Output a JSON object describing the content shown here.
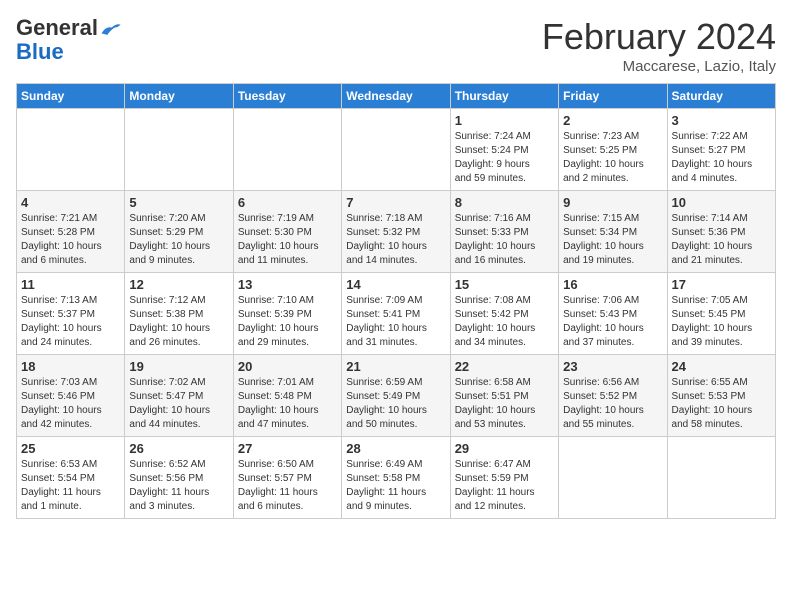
{
  "header": {
    "logo_general": "General",
    "logo_blue": "Blue",
    "month_year": "February 2024",
    "location": "Maccarese, Lazio, Italy"
  },
  "weekdays": [
    "Sunday",
    "Monday",
    "Tuesday",
    "Wednesday",
    "Thursday",
    "Friday",
    "Saturday"
  ],
  "weeks": [
    [
      {
        "day": "",
        "info": ""
      },
      {
        "day": "",
        "info": ""
      },
      {
        "day": "",
        "info": ""
      },
      {
        "day": "",
        "info": ""
      },
      {
        "day": "1",
        "info": "Sunrise: 7:24 AM\nSunset: 5:24 PM\nDaylight: 9 hours\nand 59 minutes."
      },
      {
        "day": "2",
        "info": "Sunrise: 7:23 AM\nSunset: 5:25 PM\nDaylight: 10 hours\nand 2 minutes."
      },
      {
        "day": "3",
        "info": "Sunrise: 7:22 AM\nSunset: 5:27 PM\nDaylight: 10 hours\nand 4 minutes."
      }
    ],
    [
      {
        "day": "4",
        "info": "Sunrise: 7:21 AM\nSunset: 5:28 PM\nDaylight: 10 hours\nand 6 minutes."
      },
      {
        "day": "5",
        "info": "Sunrise: 7:20 AM\nSunset: 5:29 PM\nDaylight: 10 hours\nand 9 minutes."
      },
      {
        "day": "6",
        "info": "Sunrise: 7:19 AM\nSunset: 5:30 PM\nDaylight: 10 hours\nand 11 minutes."
      },
      {
        "day": "7",
        "info": "Sunrise: 7:18 AM\nSunset: 5:32 PM\nDaylight: 10 hours\nand 14 minutes."
      },
      {
        "day": "8",
        "info": "Sunrise: 7:16 AM\nSunset: 5:33 PM\nDaylight: 10 hours\nand 16 minutes."
      },
      {
        "day": "9",
        "info": "Sunrise: 7:15 AM\nSunset: 5:34 PM\nDaylight: 10 hours\nand 19 minutes."
      },
      {
        "day": "10",
        "info": "Sunrise: 7:14 AM\nSunset: 5:36 PM\nDaylight: 10 hours\nand 21 minutes."
      }
    ],
    [
      {
        "day": "11",
        "info": "Sunrise: 7:13 AM\nSunset: 5:37 PM\nDaylight: 10 hours\nand 24 minutes."
      },
      {
        "day": "12",
        "info": "Sunrise: 7:12 AM\nSunset: 5:38 PM\nDaylight: 10 hours\nand 26 minutes."
      },
      {
        "day": "13",
        "info": "Sunrise: 7:10 AM\nSunset: 5:39 PM\nDaylight: 10 hours\nand 29 minutes."
      },
      {
        "day": "14",
        "info": "Sunrise: 7:09 AM\nSunset: 5:41 PM\nDaylight: 10 hours\nand 31 minutes."
      },
      {
        "day": "15",
        "info": "Sunrise: 7:08 AM\nSunset: 5:42 PM\nDaylight: 10 hours\nand 34 minutes."
      },
      {
        "day": "16",
        "info": "Sunrise: 7:06 AM\nSunset: 5:43 PM\nDaylight: 10 hours\nand 37 minutes."
      },
      {
        "day": "17",
        "info": "Sunrise: 7:05 AM\nSunset: 5:45 PM\nDaylight: 10 hours\nand 39 minutes."
      }
    ],
    [
      {
        "day": "18",
        "info": "Sunrise: 7:03 AM\nSunset: 5:46 PM\nDaylight: 10 hours\nand 42 minutes."
      },
      {
        "day": "19",
        "info": "Sunrise: 7:02 AM\nSunset: 5:47 PM\nDaylight: 10 hours\nand 44 minutes."
      },
      {
        "day": "20",
        "info": "Sunrise: 7:01 AM\nSunset: 5:48 PM\nDaylight: 10 hours\nand 47 minutes."
      },
      {
        "day": "21",
        "info": "Sunrise: 6:59 AM\nSunset: 5:49 PM\nDaylight: 10 hours\nand 50 minutes."
      },
      {
        "day": "22",
        "info": "Sunrise: 6:58 AM\nSunset: 5:51 PM\nDaylight: 10 hours\nand 53 minutes."
      },
      {
        "day": "23",
        "info": "Sunrise: 6:56 AM\nSunset: 5:52 PM\nDaylight: 10 hours\nand 55 minutes."
      },
      {
        "day": "24",
        "info": "Sunrise: 6:55 AM\nSunset: 5:53 PM\nDaylight: 10 hours\nand 58 minutes."
      }
    ],
    [
      {
        "day": "25",
        "info": "Sunrise: 6:53 AM\nSunset: 5:54 PM\nDaylight: 11 hours\nand 1 minute."
      },
      {
        "day": "26",
        "info": "Sunrise: 6:52 AM\nSunset: 5:56 PM\nDaylight: 11 hours\nand 3 minutes."
      },
      {
        "day": "27",
        "info": "Sunrise: 6:50 AM\nSunset: 5:57 PM\nDaylight: 11 hours\nand 6 minutes."
      },
      {
        "day": "28",
        "info": "Sunrise: 6:49 AM\nSunset: 5:58 PM\nDaylight: 11 hours\nand 9 minutes."
      },
      {
        "day": "29",
        "info": "Sunrise: 6:47 AM\nSunset: 5:59 PM\nDaylight: 11 hours\nand 12 minutes."
      },
      {
        "day": "",
        "info": ""
      },
      {
        "day": "",
        "info": ""
      }
    ]
  ]
}
